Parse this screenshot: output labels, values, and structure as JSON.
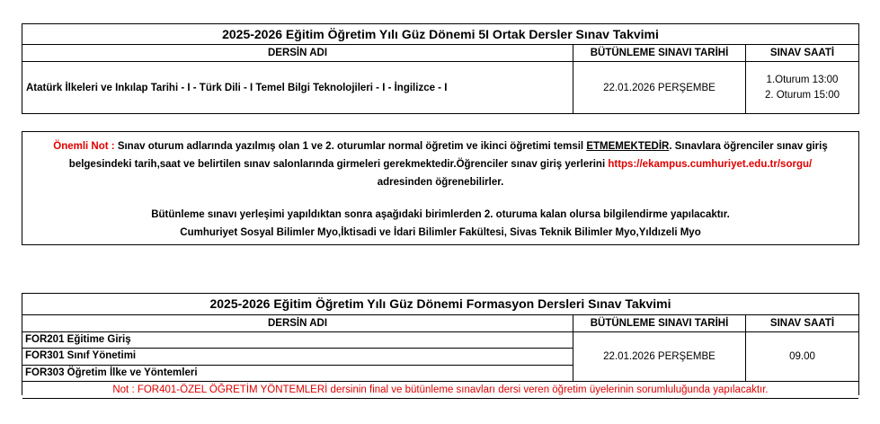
{
  "table1": {
    "title": "2025-2026 Eğitim Öğretim Yılı Güz Dönemi 5I Ortak Dersler Sınav Takvimi",
    "headers": [
      "DERSİN ADI",
      "BÜTÜNLEME SINAVI TARİHİ",
      "SINAV SAATİ"
    ],
    "row": {
      "course": "Atatürk İlkeleri ve Inkılap Tarihi - I -  Türk Dili - I   Temel Bilgi Teknolojileri - I - İngilizce - I",
      "date": "22.01.2026 PERŞEMBE",
      "time1": "1.Oturum 13:00",
      "time2": "2. Oturum 15:00"
    }
  },
  "note": {
    "label": "Önemli Not :",
    "text1": " Sınav oturum adlarında yazılmış olan 1 ve 2. oturumlar normal öğretim ve ikinci öğretimi temsil ",
    "emphasis": "ETMEMEKTEDİR",
    "text2": ". Sınavlara öğrenciler sınav giriş",
    "line2a": "belgesindeki tarih,saat ve belirtilen sınav salonlarında girmeleri gerekmektedir.Öğrenciler sınav giriş yerlerini ",
    "link": "https://ekampus.cumhuriyet.edu.tr/sorgu/",
    "line3": "adresinden öğrenebilirler.",
    "line4": "Bütünleme sınavı yerleşimi yapıldıktan sonra aşağıdaki birimlerden 2. oturuma kalan olursa bilgilendirme yapılacaktır.",
    "line5": "Cumhuriyet Sosyal Bilimler Myo,İktisadi ve İdari Bilimler Fakültesi, Sivas Teknik Bilimler Myo,Yıldızeli Myo"
  },
  "table2": {
    "title": "2025-2026 Eğitim Öğretim Yılı Güz Dönemi Formasyon Dersleri Sınav Takvimi",
    "headers": [
      "DERSİN ADI",
      "BÜTÜNLEME SINAVI TARİHİ",
      "SINAV SAATİ"
    ],
    "courses": [
      "FOR201 Eğitime Giriş",
      "FOR301 Sınıf Yönetimi",
      "FOR303 Öğretim İlke ve Yöntemleri"
    ],
    "date": "22.01.2026 PERŞEMBE",
    "time": "09.00",
    "footnote": "Not : FOR401-ÖZEL ÖĞRETİM YÖNTEMLERİ  dersinin final ve bütünleme sınavları dersi veren öğretim üyelerinin sorumluluğunda yapılacaktır."
  }
}
